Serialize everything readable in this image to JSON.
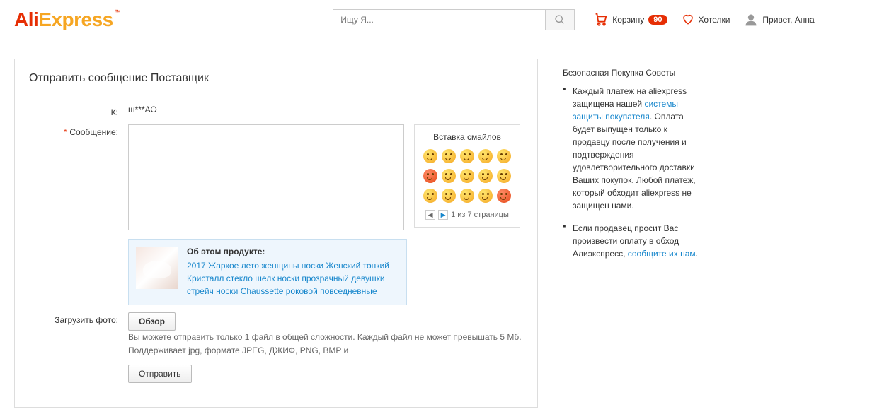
{
  "header": {
    "logo_p1": "Ali",
    "logo_p2": "Express",
    "tm": "™",
    "search_placeholder": "Ищу Я...",
    "cart_label": "Корзину",
    "cart_count": "90",
    "wishlist_label": "Хотелки",
    "greeting": "Привет, Анна"
  },
  "form": {
    "page_title": "Отправить сообщение Поставщик",
    "to_label": "К:",
    "to_value": "ш***АО",
    "msg_label": "Сообщение:",
    "smiley_title": "Вставка смайлов",
    "pager_text": "1 из 7 страницы",
    "product_title": "Об этом продукте:",
    "product_link": "2017 Жаркое лето женщины носки Женский тонкий Кристалл стекло шелк носки прозрачный девушки стрейч носки Chaussette роковой повседневные",
    "upload_label": "Загрузить фото:",
    "browse_btn": "Обзор",
    "upload_hint1": "Вы можете отправить только 1 файл в общей сложности. Каждый файл не может превышать 5 Мб.",
    "upload_hint2": "Поддерживает jpg, формате JPEG, ДЖИФ, PNG, BMP и",
    "send_btn": "Отправить"
  },
  "tips": {
    "title": "Безопасная Покупка Советы",
    "t1a": "Каждый платеж на aliexpress защищена нашей ",
    "t1link": "системы защиты покупателя",
    "t1b": ". Оплата будет выпущен только к продавцу после получения и подтверждения удовлетворительного доставки Ваших покупок. Любой платеж, который обходит aliexpress не защищен нами.",
    "t2a": "Если продавец просит Вас произвести оплату в обход Алиэкспресс, ",
    "t2link": "сообщите их нам",
    "t2b": "."
  }
}
